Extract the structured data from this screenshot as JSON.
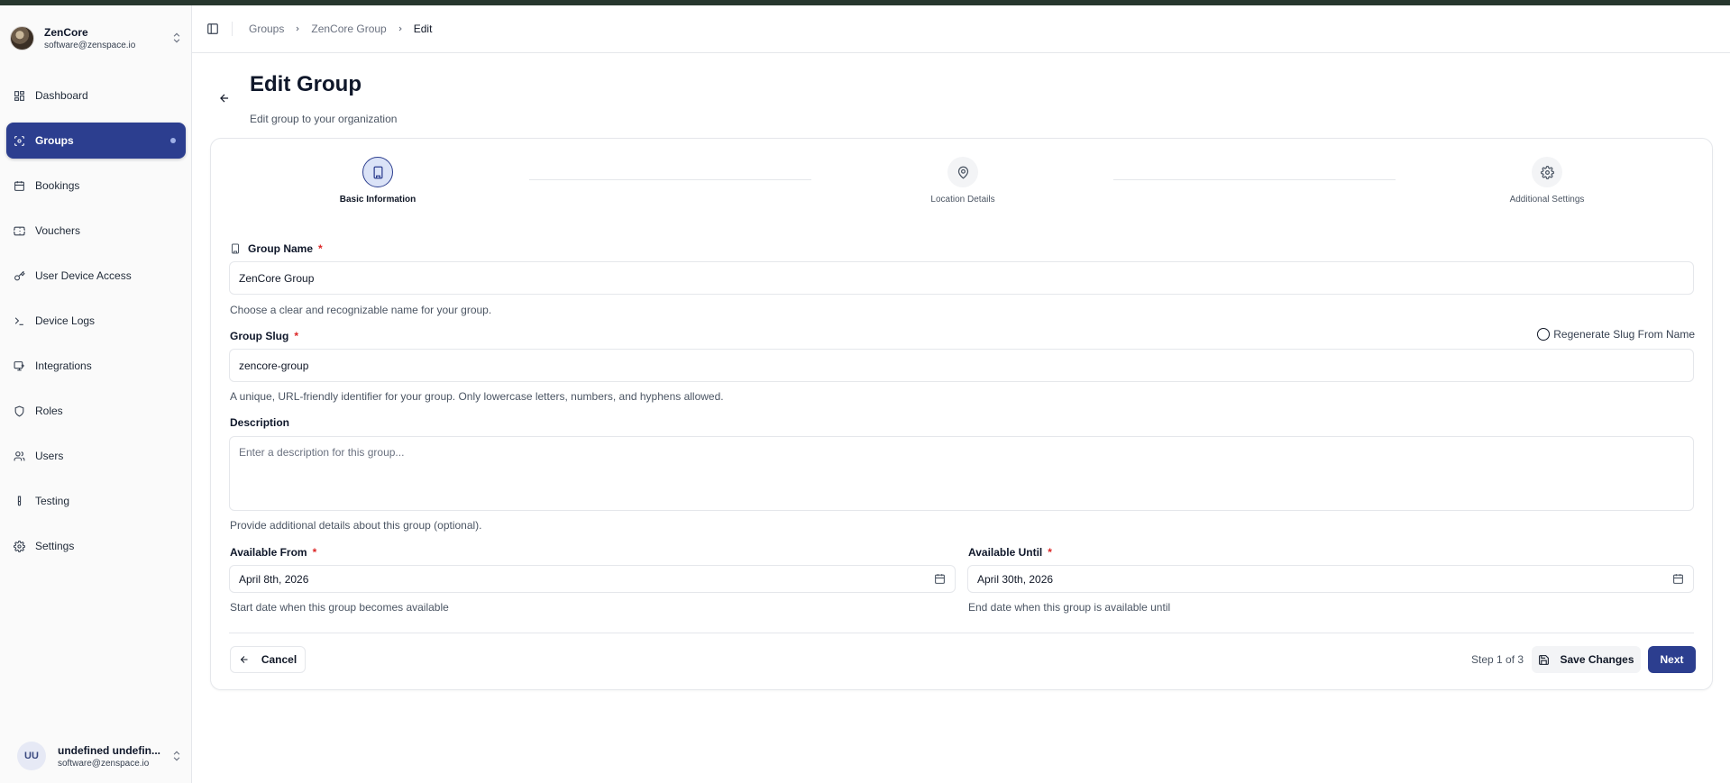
{
  "org": {
    "name": "ZenCore",
    "email": "software@zenspace.io"
  },
  "sidebar": {
    "items": [
      {
        "label": "Dashboard",
        "icon": "layout-dashboard-icon"
      },
      {
        "label": "Groups",
        "icon": "groups-icon",
        "active": true
      },
      {
        "label": "Bookings",
        "icon": "calendar-icon"
      },
      {
        "label": "Vouchers",
        "icon": "ticket-icon"
      },
      {
        "label": "User Device Access",
        "icon": "key-icon"
      },
      {
        "label": "Device Logs",
        "icon": "terminal-icon"
      },
      {
        "label": "Integrations",
        "icon": "integrations-icon"
      },
      {
        "label": "Roles",
        "icon": "shield-icon"
      },
      {
        "label": "Users",
        "icon": "users-icon"
      },
      {
        "label": "Testing",
        "icon": "test-tube-icon"
      },
      {
        "label": "Settings",
        "icon": "gear-icon"
      }
    ]
  },
  "user": {
    "initials": "UU",
    "name": "undefined undefin...",
    "email": "software@zenspace.io"
  },
  "breadcrumb": {
    "items": [
      "Groups",
      "ZenCore Group",
      "Edit"
    ]
  },
  "page": {
    "title": "Edit Group",
    "subtitle": "Edit group to your organization"
  },
  "steps": [
    {
      "label": "Basic Information",
      "icon": "building-icon",
      "active": true
    },
    {
      "label": "Location Details",
      "icon": "map-pin-icon"
    },
    {
      "label": "Additional Settings",
      "icon": "gear-icon"
    }
  ],
  "form": {
    "group_name": {
      "label": "Group Name",
      "required_mark": "*",
      "value": "ZenCore Group",
      "help": "Choose a clear and recognizable name for your group."
    },
    "group_slug": {
      "label": "Group Slug",
      "required_mark": "*",
      "value": "zencore-group",
      "help": "A unique, URL-friendly identifier for your group. Only lowercase letters, numbers, and hyphens allowed.",
      "regenerate_label": "Regenerate Slug From Name"
    },
    "description": {
      "label": "Description",
      "placeholder": "Enter a description for this group...",
      "help": "Provide additional details about this group (optional)."
    },
    "available_from": {
      "label": "Available From",
      "required_mark": "*",
      "value": "April 8th, 2026",
      "help": "Start date when this group becomes available"
    },
    "available_until": {
      "label": "Available Until",
      "required_mark": "*",
      "value": "April 30th, 2026",
      "help": "End date when this group is available until"
    }
  },
  "footer": {
    "cancel_label": "Cancel",
    "step_text": "Step 1 of 3",
    "save_label": "Save Changes",
    "next_label": "Next"
  },
  "colors": {
    "accent": "#2c3e8f",
    "required": "#dc2626",
    "topbar": "#27372e"
  }
}
